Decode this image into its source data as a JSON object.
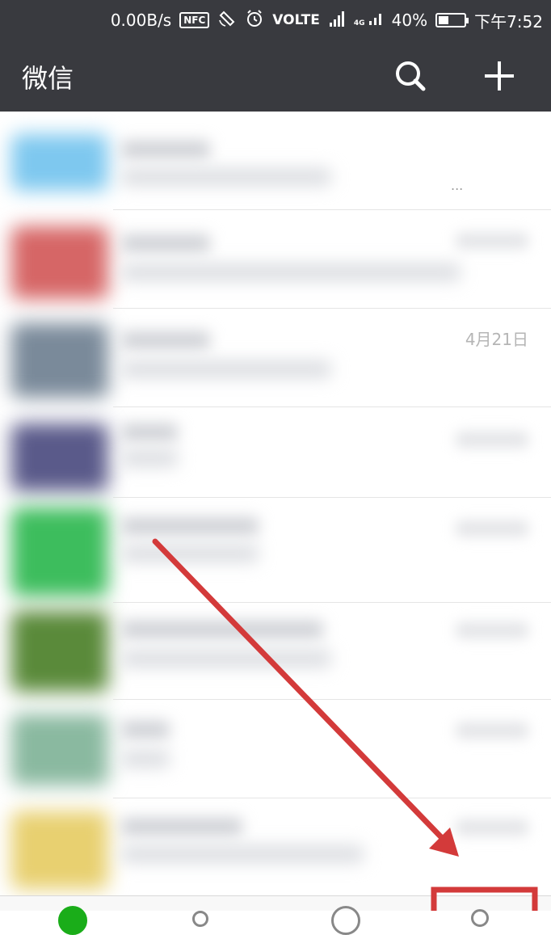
{
  "status_bar": {
    "speed": "0.00B/s",
    "nfc": "NFC",
    "volte": "VOLTE",
    "network": "4G",
    "battery": "40%",
    "battery_level": 0.4,
    "time": "下午7:52"
  },
  "nav": {
    "title": "微信",
    "search_icon": "search-icon",
    "add_icon": "plus-icon"
  },
  "chats": [
    {
      "time": "",
      "avatar_color": "#7ec8ef"
    },
    {
      "time": "",
      "avatar_color": "#d66666"
    },
    {
      "time": "4月21日",
      "avatar_color": "#7a8a9a"
    },
    {
      "time": "",
      "avatar_color": "#5a5a8a"
    },
    {
      "time": "",
      "avatar_color": "#3dbd5d"
    },
    {
      "time": "",
      "avatar_color": "#5a8a3a"
    },
    {
      "time": "",
      "avatar_color": "#8ab9a0"
    },
    {
      "time": "",
      "avatar_color": "#e8d070"
    }
  ],
  "ellipsis": "...",
  "tabs": [
    {
      "icon": "chats-icon"
    },
    {
      "icon": "contacts-icon"
    },
    {
      "icon": "discover-icon"
    },
    {
      "icon": "me-icon"
    }
  ],
  "annotation": {
    "color": "#d33a3a"
  }
}
